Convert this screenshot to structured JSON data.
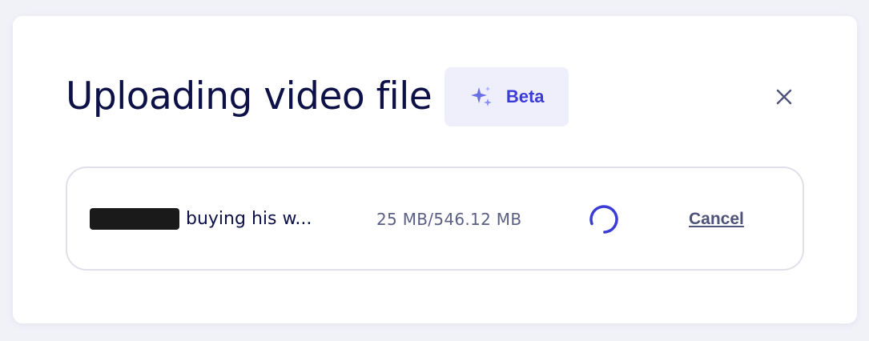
{
  "dialog": {
    "title": "Uploading video file",
    "badge": {
      "label": "Beta",
      "icon": "sparkle-icon"
    },
    "close_icon": "close-icon"
  },
  "upload": {
    "file_name": "buying his w...",
    "size_text": "25 MB/546.12 MB",
    "status_icon": "spinner-icon",
    "cancel_label": "Cancel"
  },
  "colors": {
    "title": "#0d1147",
    "accent": "#3b3bd6",
    "badge_bg": "#eeeffb",
    "muted_text": "#5b5f85",
    "card_border": "#dfe0ea",
    "page_bg": "#f1f1f8"
  }
}
